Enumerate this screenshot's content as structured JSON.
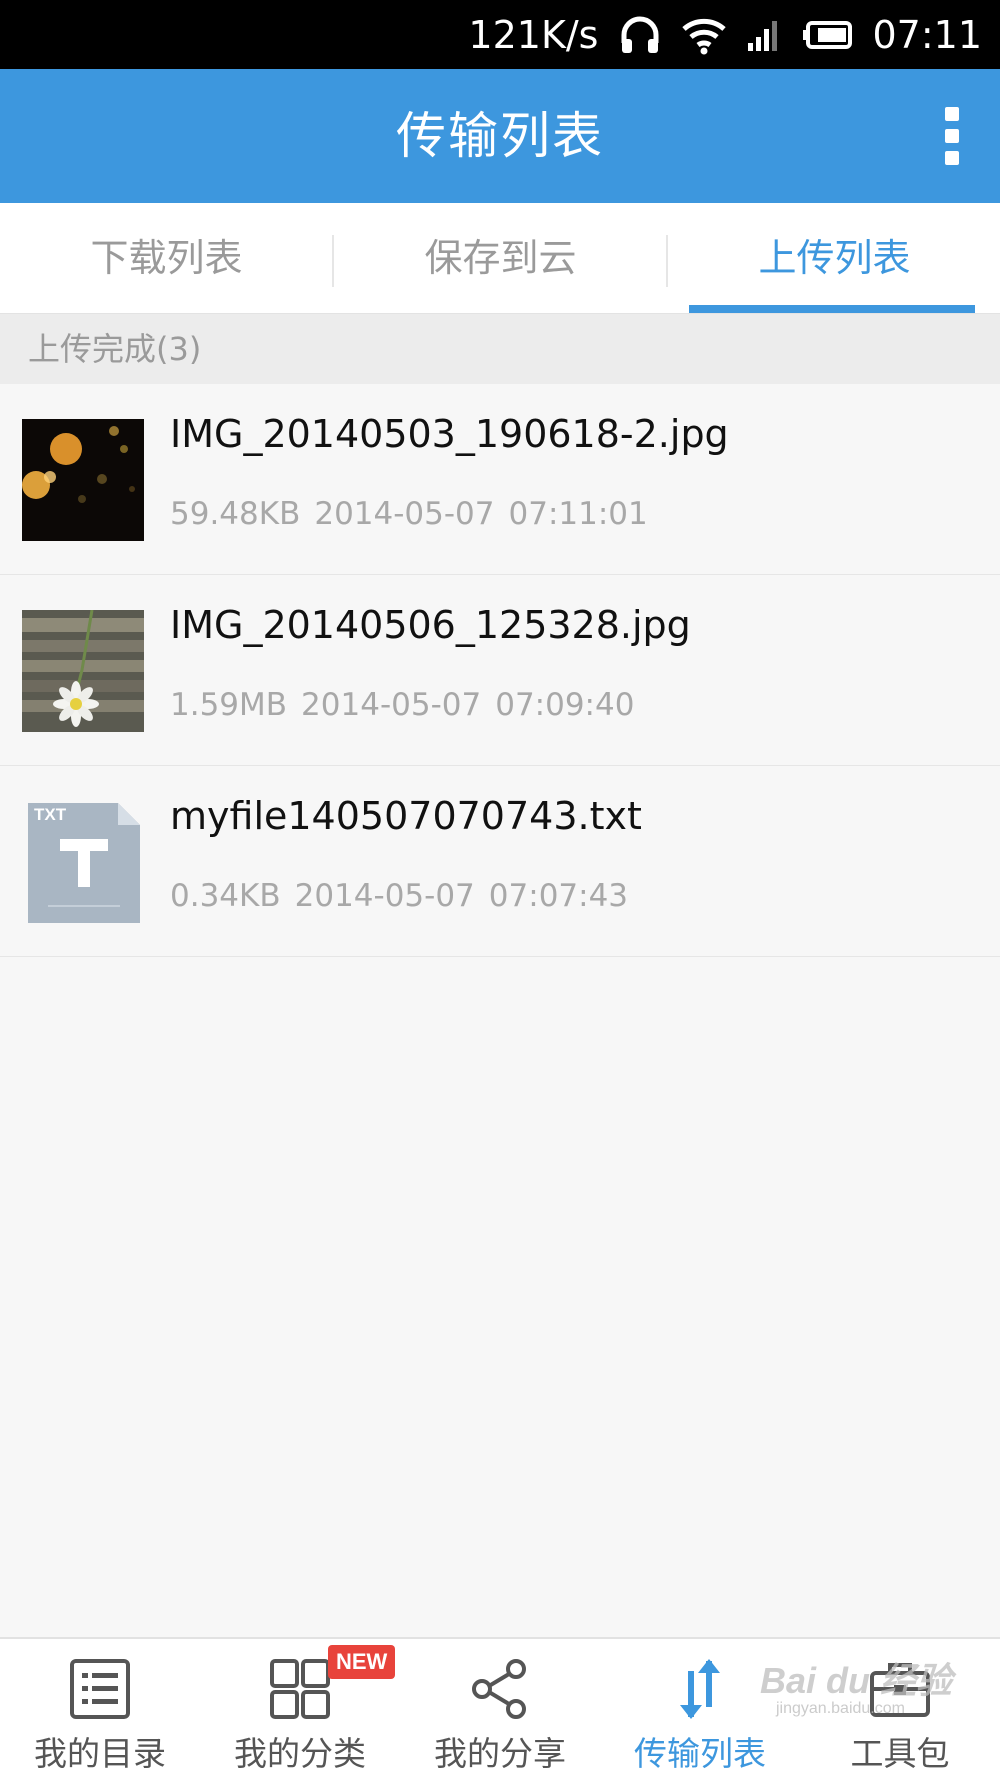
{
  "status_bar": {
    "speed": "121K/s",
    "time": "07:11",
    "icons": [
      "headphones-icon",
      "wifi-icon",
      "signal-icon",
      "battery-icon"
    ]
  },
  "header": {
    "title": "传输列表",
    "menu_icon": "more-vertical-icon"
  },
  "tabs": [
    {
      "label": "下载列表",
      "active": false
    },
    {
      "label": "保存到云",
      "active": false
    },
    {
      "label": "上传列表",
      "active": true
    }
  ],
  "section": {
    "label": "上传完成(3)"
  },
  "files": [
    {
      "name": "IMG_20140503_190618-2.jpg",
      "size": "59.48KB",
      "date": "2014-05-07",
      "time": "07:11:01",
      "thumb": "photo-bokeh"
    },
    {
      "name": "IMG_20140506_125328.jpg",
      "size": "1.59MB",
      "date": "2014-05-07",
      "time": "07:09:40",
      "thumb": "photo-flower"
    },
    {
      "name": "myfile140507070743.txt",
      "size": "0.34KB",
      "date": "2014-05-07",
      "time": "07:07:43",
      "thumb": "txt-file-icon",
      "thumb_label": "TXT"
    }
  ],
  "bottom_nav": [
    {
      "label": "我的目录",
      "icon": "list-icon",
      "active": false
    },
    {
      "label": "我的分类",
      "icon": "grid-icon",
      "active": false,
      "badge": "NEW"
    },
    {
      "label": "我的分享",
      "icon": "share-icon",
      "active": false
    },
    {
      "label": "传输列表",
      "icon": "transfer-icon",
      "active": true
    },
    {
      "label": "工具包",
      "icon": "toolbox-icon",
      "active": false
    }
  ],
  "watermark": {
    "brand": "Bai du 经验",
    "url": "jingyan.baidu.com"
  },
  "colors": {
    "accent": "#3d97de",
    "badge": "#e8433b",
    "background": "#f7f7f7"
  }
}
